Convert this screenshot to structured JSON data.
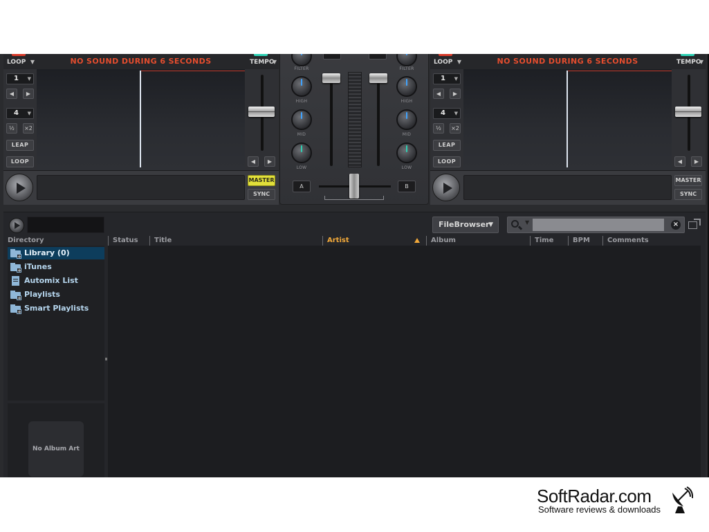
{
  "decks": [
    {
      "id": "left",
      "loop_mode": "LOOP",
      "tempo_label": "TEMPO",
      "warning": "NO SOUND DURING 6 SECONDS",
      "loop_size_1": "1",
      "loop_size_2": "4",
      "half_label": "½",
      "double_label": "×2",
      "leap_label": "LEAP",
      "loop_label": "LOOP",
      "master_label": "MASTER",
      "master_active": true,
      "sync_label": "SYNC"
    },
    {
      "id": "right",
      "loop_mode": "LOOP",
      "tempo_label": "TEMPO",
      "warning": "NO SOUND DURING 6 SECONDS",
      "loop_size_1": "1",
      "loop_size_2": "4",
      "half_label": "½",
      "double_label": "×2",
      "leap_label": "LEAP",
      "loop_label": "LOOP",
      "master_label": "MASTER",
      "master_active": false,
      "sync_label": "SYNC"
    }
  ],
  "mixer": {
    "eq_labels": [
      "FILTER",
      "HIGH",
      "MID",
      "LOW"
    ],
    "crossfader_left": "A",
    "crossfader_right": "B"
  },
  "browser": {
    "view_button": "FileBrowser",
    "search_placeholder": "",
    "tree_header": "Directory",
    "tree_items": [
      {
        "label": "Library (0)",
        "icon": "folder-icon",
        "selected": true
      },
      {
        "label": "iTunes",
        "icon": "folder-icon",
        "selected": false
      },
      {
        "label": "Automix List",
        "icon": "document-icon",
        "selected": false
      },
      {
        "label": "Playlists",
        "icon": "folder-icon",
        "selected": false
      },
      {
        "label": "Smart Playlists",
        "icon": "folder-icon",
        "selected": false
      }
    ],
    "columns": [
      "Status",
      "Title",
      "Artist",
      "Album",
      "Time",
      "BPM",
      "Comments"
    ],
    "sorted_column": "Artist",
    "album_art_text": "No Album Art"
  },
  "watermark": {
    "title": "SoftRadar.com",
    "subtitle": "Software reviews & downloads"
  },
  "colors": {
    "warning": "#e54d2e",
    "master_on": "#e2e03a",
    "sort_highlight": "#f2a93a",
    "selection": "#0d3d5c",
    "knob_blue": "#3fa3ff",
    "knob_teal": "#2fd1b4"
  }
}
